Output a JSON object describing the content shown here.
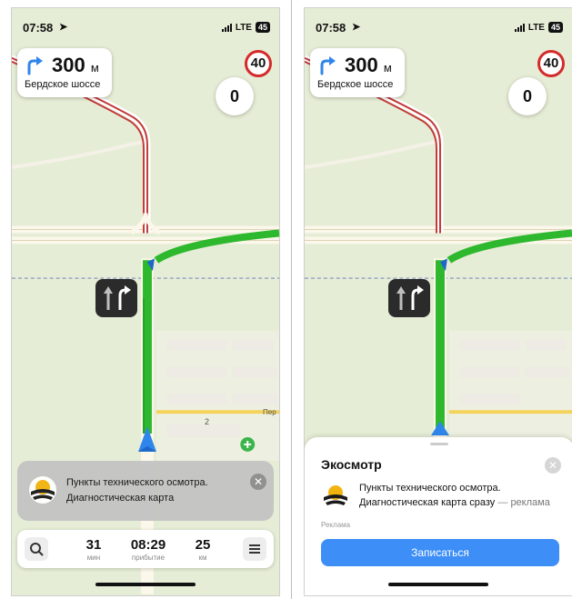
{
  "status": {
    "time": "07:58",
    "network": "LTE",
    "battery": "45"
  },
  "maneuver": {
    "distance": "300",
    "unit": "м",
    "street": "Бердское шоссе",
    "icon": "turn-right-icon"
  },
  "speed": {
    "current": "0",
    "limit": "40"
  },
  "map": {
    "street_label": "Бердское шоссе",
    "house_number": "2",
    "poi_label": "Пер"
  },
  "ad_card": {
    "line1": "Пункты технического осмотра.",
    "line2": "Диагностическая карта"
  },
  "trip": {
    "minutes": "31",
    "minutes_label": "мин",
    "arrival": "08:29",
    "arrival_label": "прибытие",
    "distance": "25",
    "distance_label": "км"
  },
  "sheet": {
    "title": "Экосмотр",
    "line1": "Пункты технического осмотра.",
    "line2_main": "Диагностическая карта сразу",
    "line2_sep": "—",
    "line2_tag": "реклама",
    "ad_label": "Реклама",
    "cta": "Записаться"
  },
  "colors": {
    "route": "#2eb82e",
    "accent": "#3d8ef7",
    "limit_ring": "#d42a2a",
    "map_bg": "#e6edd6"
  }
}
